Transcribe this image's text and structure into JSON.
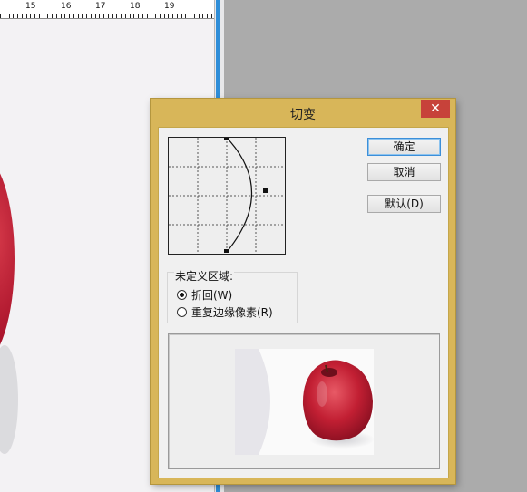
{
  "ruler": {
    "labels": [
      "15",
      "16",
      "17",
      "18",
      "19"
    ]
  },
  "dialog": {
    "title": "切变",
    "close_label": "✕",
    "buttons": {
      "ok": "确定",
      "cancel": "取消",
      "default": "默认(D)"
    },
    "undefined_area": {
      "label": "未定义区域:",
      "options": [
        {
          "label": "折回(W)",
          "selected": true
        },
        {
          "label": "重复边缘像素(R)",
          "selected": false
        }
      ]
    }
  },
  "colors": {
    "dialog_frame": "#d8b659",
    "close_button": "#c7423a",
    "apple_red": "#c21f33",
    "workspace": "#ababab"
  }
}
